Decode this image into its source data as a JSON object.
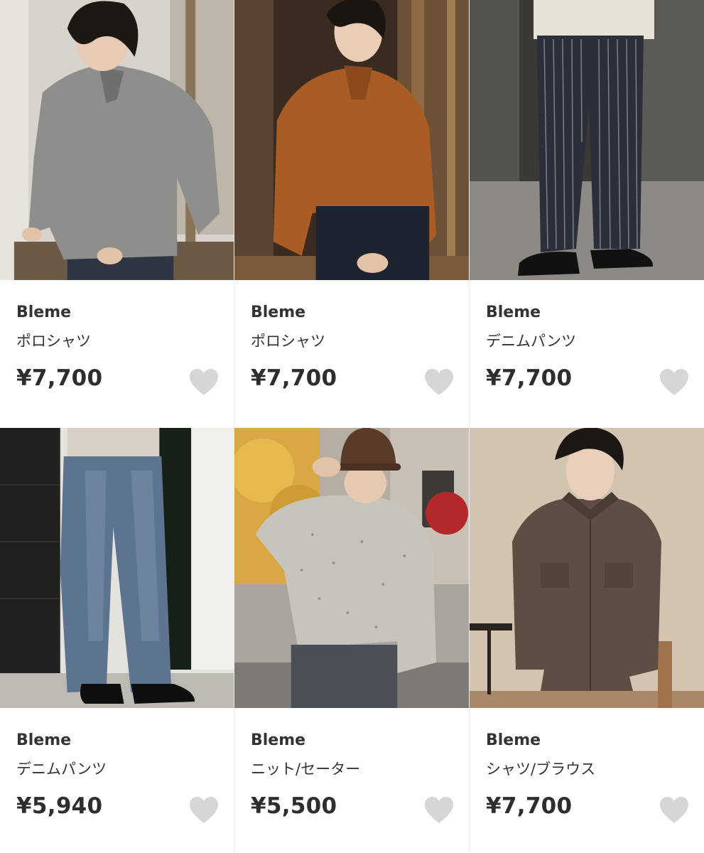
{
  "products": [
    {
      "brand": "Bleme",
      "category": "ポロシャツ",
      "price": "¥7,700",
      "favorite_icon": "heart-icon",
      "favorited": false
    },
    {
      "brand": "Bleme",
      "category": "ポロシャツ",
      "price": "¥7,700",
      "favorite_icon": "heart-icon",
      "favorited": false
    },
    {
      "brand": "Bleme",
      "category": "デニムパンツ",
      "price": "¥7,700",
      "favorite_icon": "heart-icon",
      "favorited": false
    },
    {
      "brand": "Bleme",
      "category": "デニムパンツ",
      "price": "¥5,940",
      "favorite_icon": "heart-icon",
      "favorited": false
    },
    {
      "brand": "Bleme",
      "category": "ニット/セーター",
      "price": "¥5,500",
      "favorite_icon": "heart-icon",
      "favorited": false
    },
    {
      "brand": "Bleme",
      "category": "シャツ/ブラウス",
      "price": "¥7,700",
      "favorite_icon": "heart-icon",
      "favorited": false
    }
  ],
  "colors": {
    "heart_inactive": "#d6d6d6",
    "text": "#2e2e2e",
    "divider": "#ececec"
  }
}
